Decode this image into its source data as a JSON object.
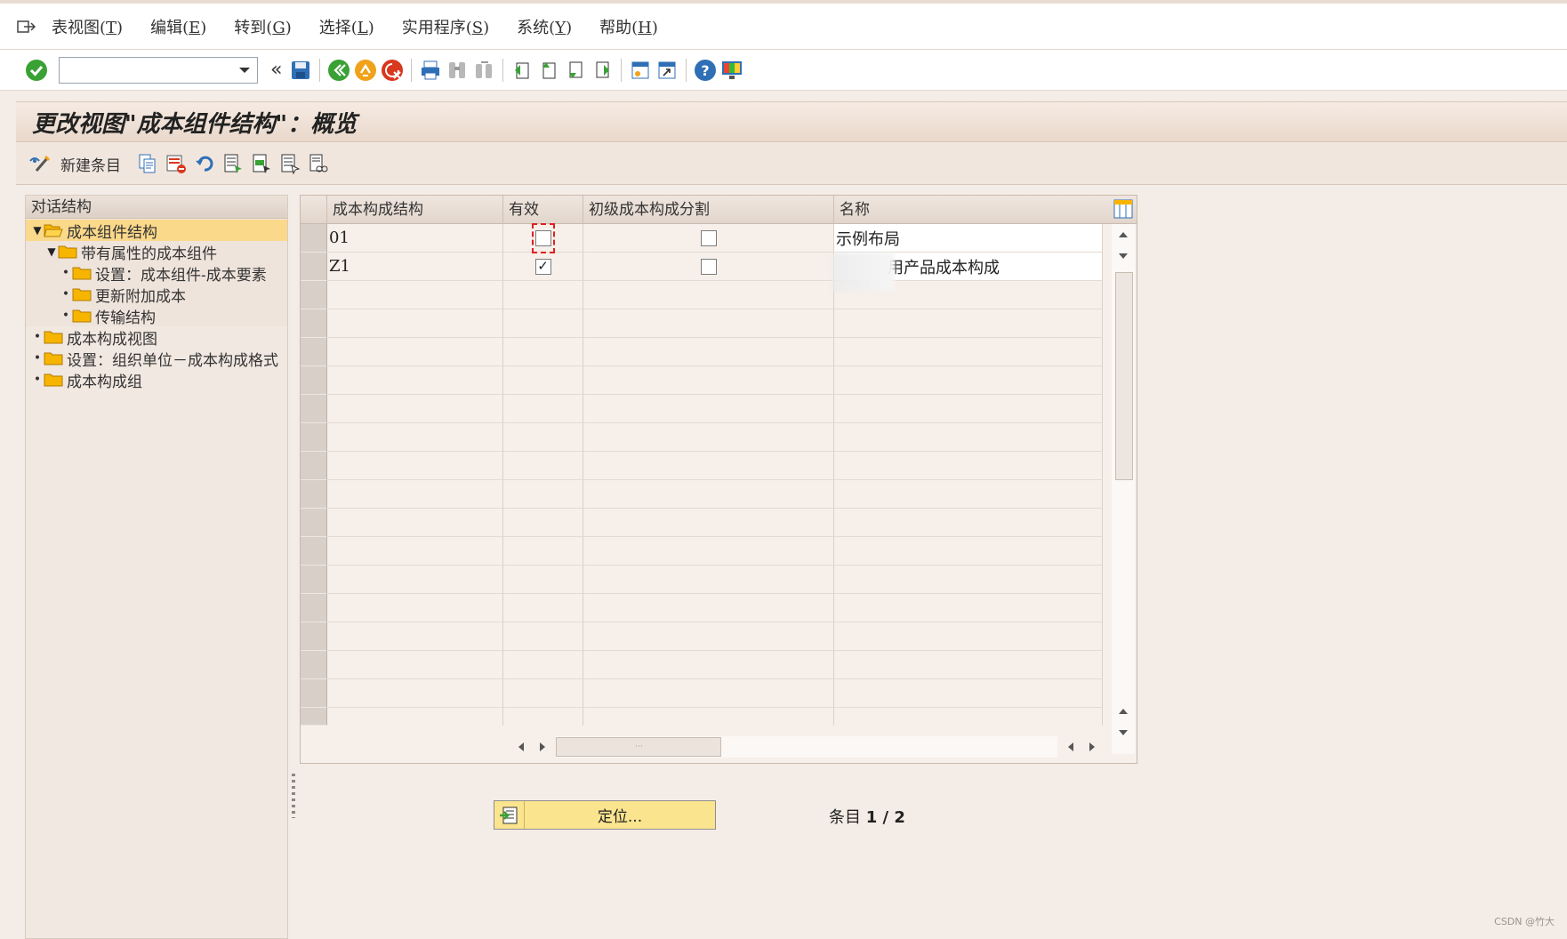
{
  "menubar": {
    "items": [
      {
        "label": "表视图(",
        "key": "T",
        "suffix": ")"
      },
      {
        "label": "编辑(",
        "key": "E",
        "suffix": ")"
      },
      {
        "label": "转到(",
        "key": "G",
        "suffix": ")"
      },
      {
        "label": "选择(",
        "key": "L",
        "suffix": ")"
      },
      {
        "label": "实用程序(",
        "key": "S",
        "suffix": ")"
      },
      {
        "label": "系统(",
        "key": "Y",
        "suffix": ")"
      },
      {
        "label": "帮助(",
        "key": "H",
        "suffix": ")"
      }
    ]
  },
  "toolbar": {
    "command_value": "",
    "back_chevron": "«"
  },
  "title": "更改视图\"成本组件结构\"：概览",
  "apptoolbar": {
    "new_entries_label": "新建条目"
  },
  "tree": {
    "header": "对话结构",
    "nodes": [
      {
        "label": "成本组件结构"
      },
      {
        "label": "带有属性的成本组件"
      },
      {
        "label": "设置：成本组件-成本要素"
      },
      {
        "label": "更新附加成本"
      },
      {
        "label": "传输结构"
      },
      {
        "label": "成本构成视图"
      },
      {
        "label": "设置：组织单位－成本构成格式"
      },
      {
        "label": "成本构成组"
      }
    ]
  },
  "table": {
    "columns": [
      "成本构成结构",
      "有效",
      "初级成本构成分割",
      "名称"
    ],
    "rows": [
      {
        "structure": "01",
        "active": false,
        "primary_split": false,
        "name": "示例布局"
      },
      {
        "structure": "Z1",
        "active": true,
        "primary_split": false,
        "name": "用产品成本构成"
      }
    ],
    "check_mark": "✓"
  },
  "position_button": {
    "label": "定位..."
  },
  "entry_counter": {
    "label": "条目",
    "value": "1 / 2"
  },
  "watermark": "CSDN @竹大",
  "colors": {
    "accent_green": "#3aa135",
    "selected_node": "#fbd98a",
    "position_button": "#fbe48e",
    "focus_red": "#e02020"
  }
}
